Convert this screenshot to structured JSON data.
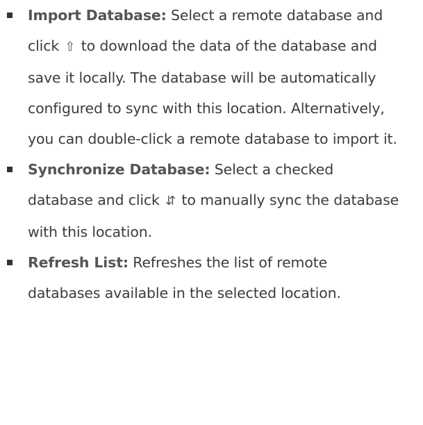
{
  "items": [
    {
      "term": "Import Database:",
      "text_before_icon": " Select a remote database and click ",
      "icon": "import-icon",
      "icon_glyph": "⇧",
      "text_after_icon": " to download the data of the database and save it locally. The database will be automatically configured to sync with this location. Alternatively, you can double-click a remote database to import it."
    },
    {
      "term": "Synchronize Database:",
      "text_before_icon": " Select a checked database and click ",
      "icon": "sync-icon",
      "icon_glyph": "⇵",
      "text_after_icon": " to manually sync the database with this location."
    },
    {
      "term": "Refresh List:",
      "text": " Refreshes the list of remote databases available in the selected location."
    }
  ],
  "colors": {
    "text": "#3c3c3c",
    "term": "#555555",
    "bullet": "#333333"
  }
}
